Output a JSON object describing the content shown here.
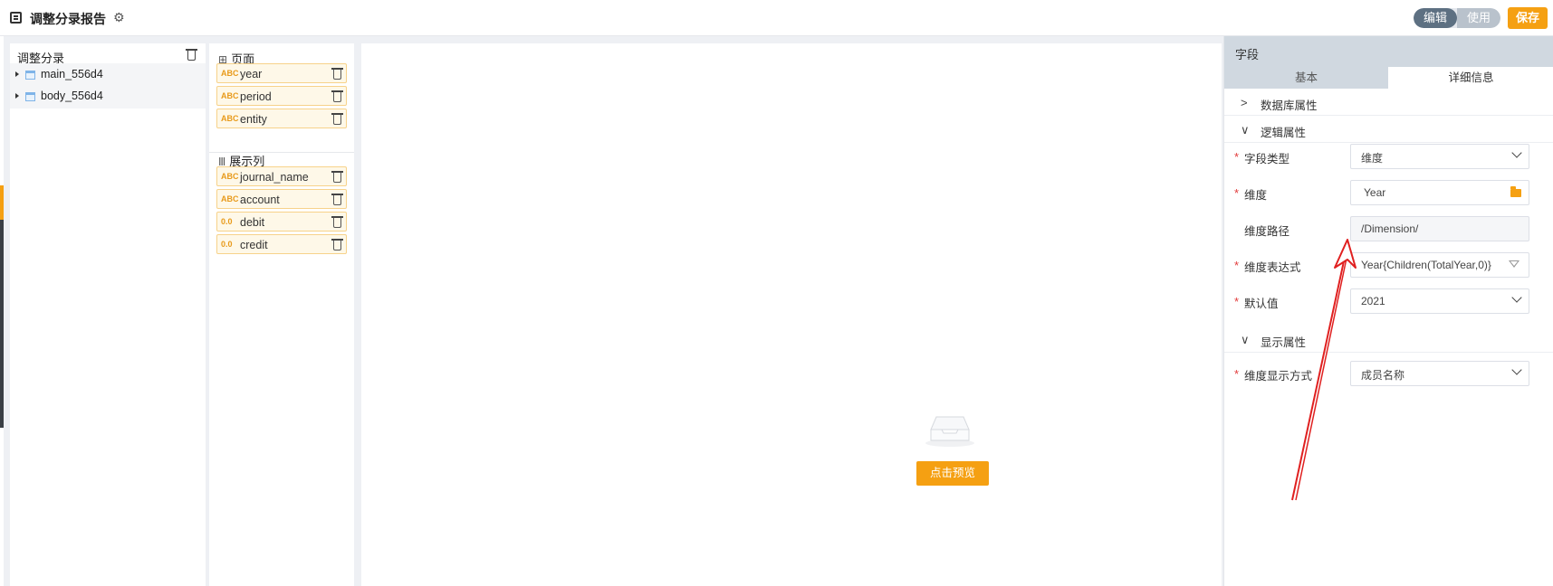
{
  "header": {
    "title": "调整分录报告",
    "mode_edit": "编辑",
    "mode_use": "使用",
    "save_label": "保存"
  },
  "tree": {
    "title": "调整分录",
    "items": [
      {
        "label": "main_556d4",
        "icon": "table-icon"
      },
      {
        "label": "body_556d4",
        "icon": "table-icon"
      }
    ]
  },
  "page_section": {
    "title": "页面",
    "fields": [
      {
        "type": "ABC",
        "name": "year"
      },
      {
        "type": "ABC",
        "name": "period"
      },
      {
        "type": "ABC",
        "name": "entity"
      }
    ]
  },
  "columns_section": {
    "title": "展示列",
    "fields": [
      {
        "type": "ABC",
        "name": "journal_name"
      },
      {
        "type": "ABC",
        "name": "account"
      },
      {
        "type": "0.0",
        "name": "debit"
      },
      {
        "type": "0.0",
        "name": "credit"
      }
    ]
  },
  "canvas": {
    "preview_label": "点击预览"
  },
  "properties": {
    "title": "字段",
    "tab_basic": "基本",
    "tab_detail": "详细信息",
    "group_db": "数据库属性",
    "group_logic": "逻辑属性",
    "group_display": "显示属性",
    "field_type_label": "字段类型",
    "field_type_value": "维度",
    "dimension_label": "维度",
    "dimension_value": "Year",
    "dimension_path_label": "维度路径",
    "dimension_path_value": "/Dimension/",
    "dimension_expr_label": "维度表达式",
    "dimension_expr_value": "Year{Children(TotalYear,0)}",
    "default_label": "默认值",
    "default_value": "2021",
    "display_mode_label": "维度显示方式",
    "display_mode_value": "成员名称"
  },
  "colors": {
    "accent": "#f5a012",
    "required": "#e23a3a",
    "annotation_arrow": "#e02020"
  }
}
